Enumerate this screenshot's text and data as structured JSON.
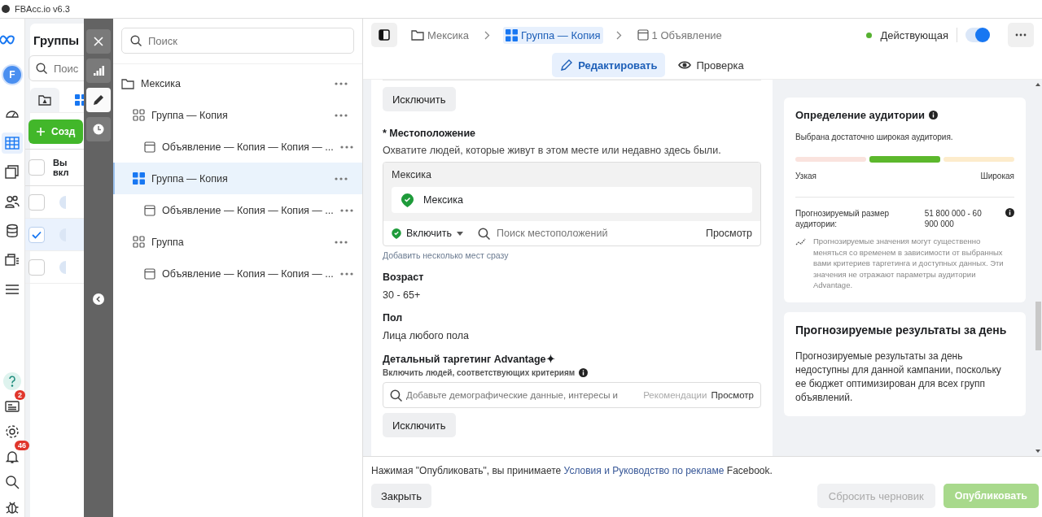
{
  "window": {
    "title": "FBAcc.io v6.3"
  },
  "nav": {
    "avatar": "F",
    "items": [
      {
        "kind": "gauge",
        "selected": false
      },
      {
        "kind": "table",
        "selected": true
      },
      {
        "kind": "docs",
        "selected": false
      },
      {
        "kind": "people",
        "selected": false
      },
      {
        "kind": "coins",
        "selected": false
      },
      {
        "kind": "cards",
        "selected": false
      },
      {
        "kind": "list",
        "selected": false
      }
    ],
    "bottom": [
      {
        "kind": "help"
      },
      {
        "kind": "news",
        "badge": "2"
      },
      {
        "kind": "gear"
      },
      {
        "kind": "bell",
        "badge": "46"
      },
      {
        "kind": "search"
      },
      {
        "kind": "bug"
      }
    ]
  },
  "background_panel": {
    "title": "Группы",
    "search": {
      "placeholder": "Поис"
    },
    "tabs": [
      {
        "kind": "folder",
        "selected": false
      },
      {
        "kind": "groups",
        "selected": true
      }
    ],
    "create_button": "Созд",
    "table": {
      "header": {
        "checked": false,
        "lines": [
          "Вы",
          "вкл"
        ]
      },
      "rows": [
        {
          "checked": false
        },
        {
          "checked": true
        },
        {
          "checked": false
        }
      ]
    }
  },
  "tool_strip": {
    "items": [
      {
        "kind": "close",
        "selected": false
      },
      {
        "kind": "chart",
        "selected": false
      },
      {
        "kind": "pencil",
        "selected": true
      },
      {
        "kind": "clock",
        "selected": false
      }
    ]
  },
  "tree": {
    "search": {
      "placeholder": "Поиск"
    },
    "items": [
      {
        "kind": "folder",
        "label": "Мексика",
        "selected": false,
        "children": [
          {
            "kind": "group",
            "label": "Группа — Копия",
            "selected": false,
            "children": [
              {
                "kind": "ad",
                "label": "Объявление — Копия — Копия — ...",
                "selected": false
              }
            ]
          },
          {
            "kind": "group",
            "label": "Группа — Копия",
            "selected": true,
            "children": [
              {
                "kind": "ad",
                "label": "Объявление — Копия — Копия — ...",
                "selected": false
              }
            ]
          },
          {
            "kind": "group",
            "label": "Группа",
            "selected": false,
            "children": [
              {
                "kind": "ad",
                "label": "Объявление — Копия — Копия — ...",
                "selected": false
              }
            ]
          }
        ]
      }
    ]
  },
  "header": {
    "breadcrumbs": [
      {
        "kind": "folder",
        "label": "Мексика",
        "selected": false
      },
      {
        "kind": "group",
        "label": "Группа — Копия",
        "selected": true
      },
      {
        "kind": "ad",
        "label": "1 Объявление",
        "selected": false
      }
    ],
    "status": {
      "label": "Действующая",
      "color": "#56b130"
    },
    "toggle": {
      "on": true
    }
  },
  "modes": [
    {
      "kind": "edit",
      "label": "Редактировать",
      "selected": true
    },
    {
      "kind": "preview",
      "label": "Проверка",
      "selected": false
    }
  ],
  "form": {
    "exclude_top": "Исключить",
    "location": {
      "label": "* Местоположение",
      "description": "Охватите людей, которые живут в этом месте или недавно здесь были.",
      "group_title": "Мексика",
      "items": [
        "Мексика"
      ],
      "include": "Включить",
      "search_placeholder": "Поиск местоположений",
      "browse": "Просмотр",
      "bulk_link": "Добавить несколько мест сразу"
    },
    "fields": [
      {
        "label": "Возраст",
        "value": "30 - 65+"
      },
      {
        "label": "Пол",
        "value": "Лица любого пола"
      }
    ],
    "detailed": {
      "label": "Детальный таргетинг Advantage✦",
      "hint": "Включить людей, соответствующих критериям",
      "placeholder": "Добавьте демографические данные, интересы и",
      "suggestions": "Рекомендации",
      "browse": "Просмотр"
    },
    "exclude_bottom": "Исключить"
  },
  "audience": {
    "title": "Определение аудитории",
    "summary": "Выбрана достаточно широкая аудитория.",
    "segments": [
      {
        "selected": false,
        "color": "#fae3de"
      },
      {
        "selected": true,
        "color": "#5cb82c"
      },
      {
        "selected": false,
        "color": "#fdeccc"
      }
    ],
    "narrow": "Узкая",
    "wide": "Широкая",
    "estimate_label": "Прогнозируемый размер аудитории:",
    "estimate_value": "51 800 000 - 60 900 000",
    "note": "Прогнозируемые значения могут существенно меняться со временем в зависимости от выбранных вами критериев таргетинга и доступных данных. Эти значения не отражают параметры аудитории Advantage."
  },
  "daily_results": {
    "title": "Прогнозируемые результаты за день",
    "text": "Прогнозируемые результаты за день недоступны для данной кампании, поскольку ее бюджет оптимизирован для всех групп объявлений."
  },
  "footer": {
    "before": "Нажимая \"Опубликовать\", вы принимаете ",
    "link": "Условия и Руководство по рекламе",
    "after": " Facebook.",
    "close": "Закрыть",
    "reset": {
      "label": "Сбросить черновик",
      "disabled": true
    },
    "publish": {
      "label": "Опубликовать",
      "disabled": true
    }
  }
}
